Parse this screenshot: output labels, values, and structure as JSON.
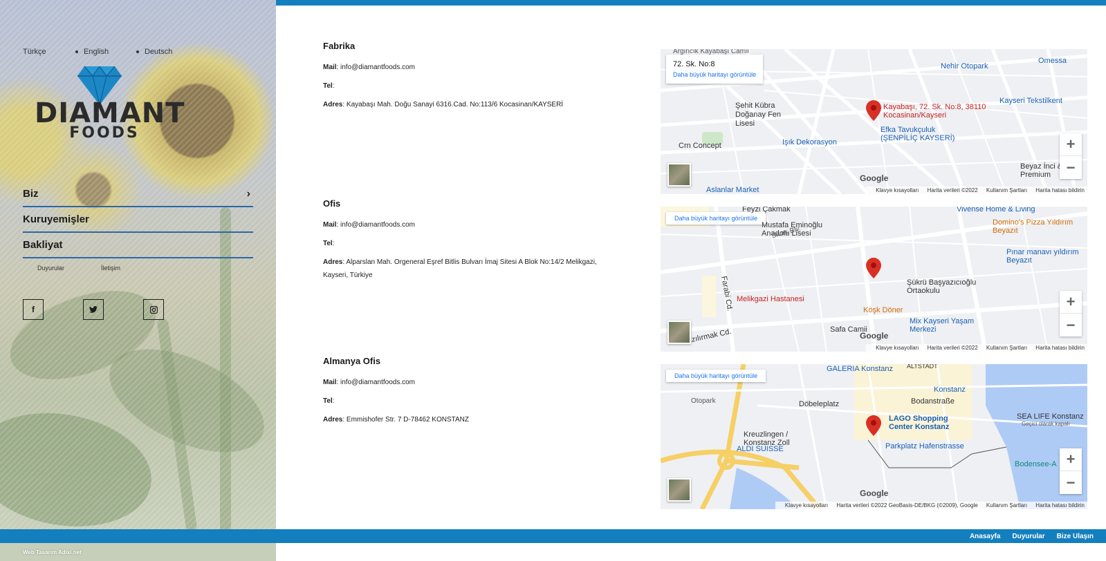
{
  "languages": [
    "Türkçe",
    "English",
    "Deutsch"
  ],
  "logo": {
    "brand": "DIAMANT",
    "sub": "FOODS"
  },
  "nav": {
    "items": [
      {
        "label": "Biz",
        "has_submenu": true
      },
      {
        "label": "Kuruyemişler",
        "has_submenu": false
      },
      {
        "label": "Bakliyat",
        "has_submenu": false
      }
    ],
    "sub_links": [
      "Duyurular",
      "İletişim"
    ]
  },
  "social": [
    {
      "icon": "facebook-icon",
      "glyph": "f"
    },
    {
      "icon": "twitter-icon",
      "glyph": "t"
    },
    {
      "icon": "instagram-icon",
      "glyph": "◙"
    }
  ],
  "locations": [
    {
      "title": "Fabrika",
      "mail_label": "Mail",
      "mail": "info@diamantfoods.com",
      "tel_label": "Tel",
      "tel": "",
      "address_label": "Adres",
      "address": "Kayabaşı Mah. Doğu Sanayi 6316.Cad. No:113/6 Kocasinan/KAYSERİ",
      "map": {
        "card_title": "72. Sk. No:8",
        "big_map_link": "Daha büyük haritayı görüntüle",
        "labels": [
          "Argıncık Kayabaşı Camii",
          "Nehir Otopark",
          "Omessa",
          "Şehit Kübra Doğanay Fen Lisesi",
          "Kayseri Tekstilkent",
          "Efka Tavukçuluk (ŞENPİLİÇ KAYSERİ)",
          "Işık Dekorasyon",
          "Crn Concept",
          "Aslanlar Market",
          "Beyaz İnci & Premium"
        ],
        "pin_label": "Kayabaşı, 72. Sk. No:8, 38110 Kocasinan/Kayseri",
        "attribution": [
          "Klavye kısayolları",
          "Harita verileri ©2022",
          "Kullanım Şartları",
          "Harita hatası bildirin"
        ]
      }
    },
    {
      "title": "Ofis",
      "mail_label": "Mail",
      "mail": "info@diamantfoods.com",
      "tel_label": "Tel",
      "tel": "",
      "address_label": "Adres",
      "address": "Alparslan Mah. Orgeneral Eşref Bitlis Bulvarı İmaj Sitesi A Blok No:14/2 Melikgazi, Kayseri, Türkiye",
      "map": {
        "big_map_link": "Daha büyük haritayı görüntüle",
        "labels": [
          "Feyzi Çakmak",
          "Vivense Home & Living",
          "Mustafa Eminoğlu Anadolu Lisesi",
          "Domino's Pizza Yıldırım Beyazıt",
          "Pınar manavı yıldırım Beyazıt",
          "Şükrü Başyazıcıoğlu Ortaokulu",
          "Melikgazi Hastanesi",
          "Köşk Döner",
          "Safa Camii",
          "Mix Kayseri Yaşam Merkezi",
          "Sivas Blv.",
          "Farabi Cd.",
          "Kızılırmak Cd."
        ],
        "attribution": [
          "Klavye kısayolları",
          "Harita verileri ©2022",
          "Kullanım Şartları",
          "Harita hatası bildirin"
        ]
      }
    },
    {
      "title": "Almanya Ofis",
      "mail_label": "Mail",
      "mail": "info@diamantfoods.com",
      "tel_label": "Tel",
      "tel": "",
      "address_label": "Adres",
      "address": "Emmishofer Str. 7 D-78462 KONSTANZ",
      "map": {
        "big_map_link": "Daha büyük haritayı görüntüle",
        "labels": [
          "GALERIA Konstanz",
          "ALTSTADT",
          "Konstanz",
          "Döbeleplatz",
          "Bodanstraße",
          "Otopark",
          "Kreuzlingen / Konstanz Zoll",
          "LAGO Shopping Center Konstanz",
          "SEA LIFE Konstanz",
          "Geçici olarak kapalı",
          "ALDI SUISSE",
          "Parkplatz Hafenstrasse",
          "Bodensee-A"
        ],
        "attribution": [
          "Klavye kısayolları",
          "Harita verileri ©2022 GeoBasis-DE/BKG (©2009), Google",
          "Kullanım Şartları",
          "Harita hatası bildirin"
        ]
      }
    }
  ],
  "footer": {
    "links": [
      "Anasayfa",
      "Duyurular",
      "Bize Ulaşın"
    ],
    "credit": "Web Tasarım Adixi.net"
  },
  "colors": {
    "accent": "#137fbf",
    "nav_underline": "#2c67a8",
    "map_link": "#1a73e8",
    "pin": "#d93025"
  }
}
